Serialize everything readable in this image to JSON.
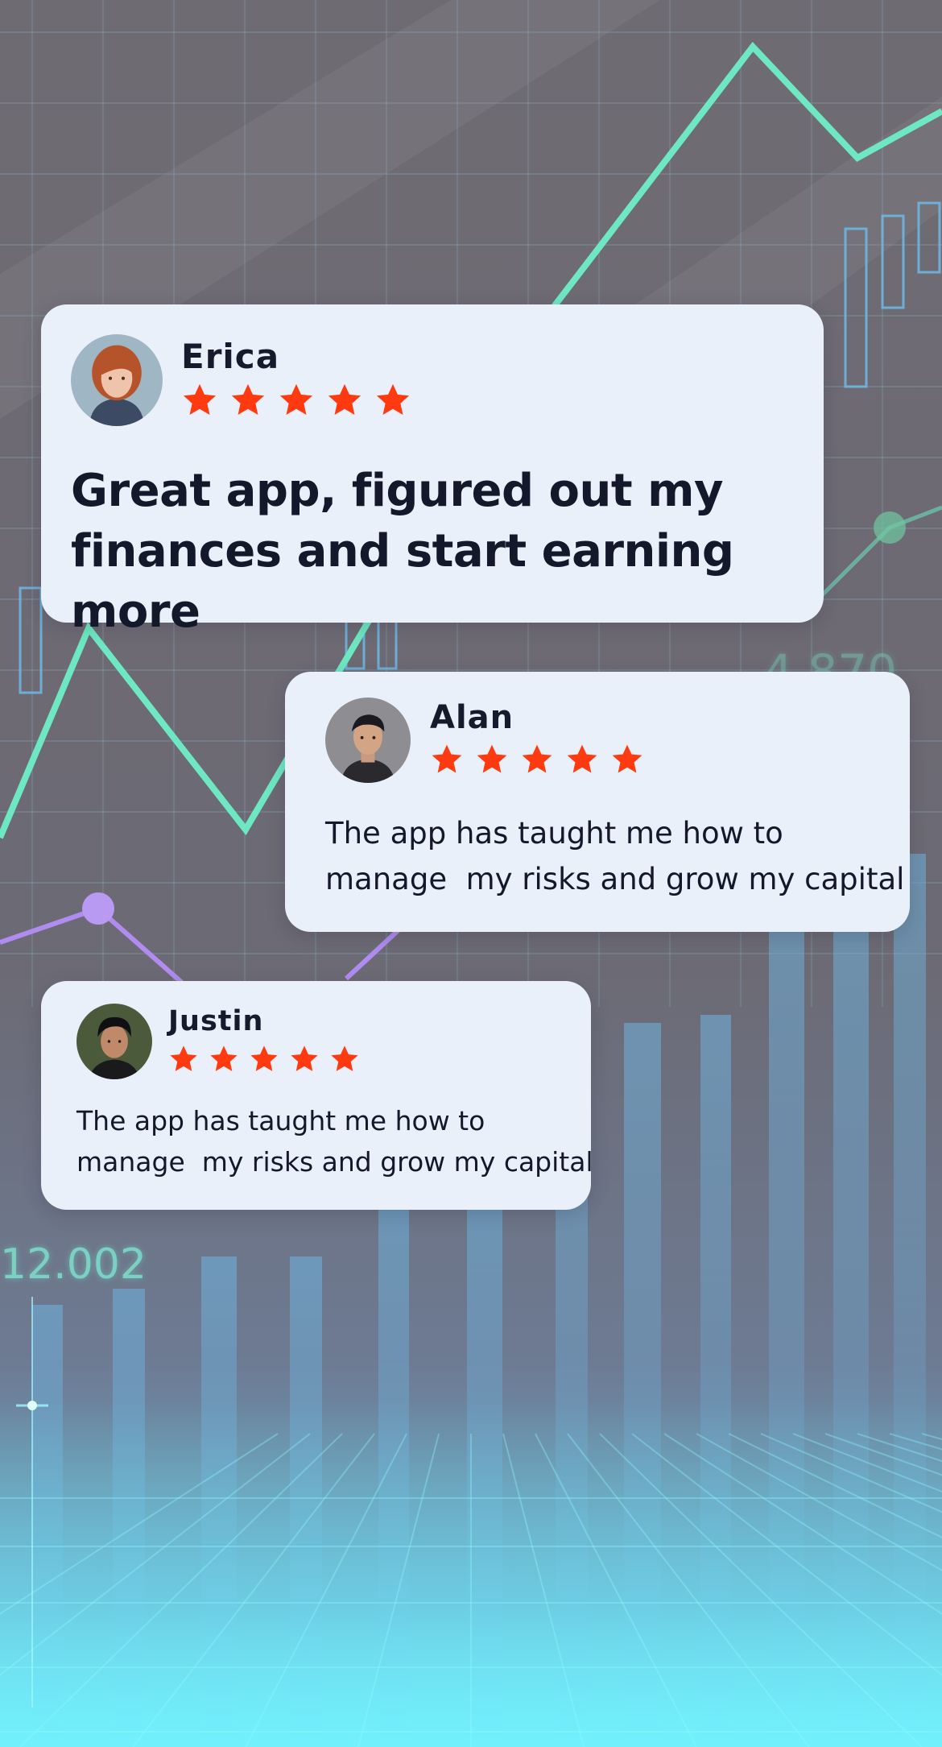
{
  "background": {
    "numbers": [
      "12.002",
      "4.870"
    ]
  },
  "reviews": [
    {
      "name": "Erica",
      "rating": 5,
      "text_line1": "Great app, figured out my",
      "text_line2": "finances and start earning more",
      "avatar_hair_color": "#b5532a"
    },
    {
      "name": "Alan",
      "rating": 5,
      "text_line1": "The app has taught me how to",
      "text_line2": "manage  my risks and grow my capital",
      "avatar_hair_color": "#1b1b1f"
    },
    {
      "name": "Justin",
      "rating": 5,
      "text_line1": "The app has taught me how to",
      "text_line2": "manage  my risks and grow my capital",
      "avatar_hair_color": "#101012"
    }
  ],
  "colors": {
    "card_bg": "#eaf0fa",
    "star": "#ff3a10",
    "text": "#14182b",
    "line_green": "#6de8c2",
    "line_purple": "#b08cf0",
    "bars_blue": "#68b4e0",
    "glow_cyan": "#6ff2ff"
  }
}
